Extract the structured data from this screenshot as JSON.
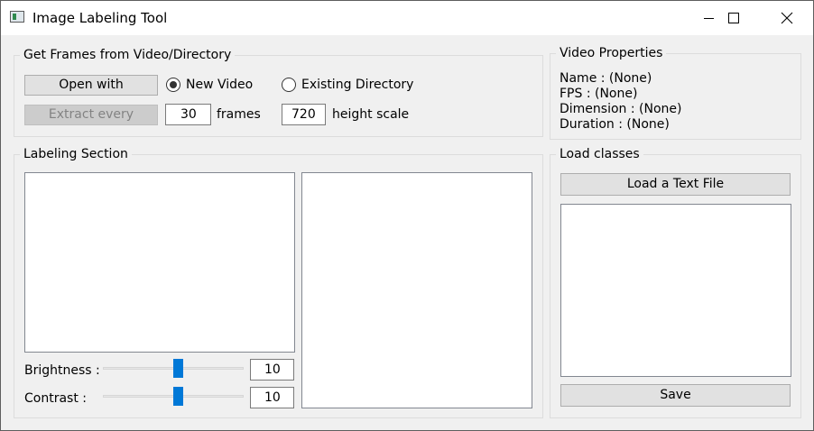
{
  "window": {
    "title": "Image Labeling Tool"
  },
  "frames_group": {
    "title": "Get Frames from Video/Directory",
    "open_with_label": "Open with",
    "new_video_label": "New Video",
    "new_video_checked": true,
    "existing_dir_label": "Existing Directory",
    "existing_dir_checked": false,
    "extract_every_label": "Extract every",
    "frames_value": "30",
    "frames_label": "frames",
    "height_value": "720",
    "height_label": "height scale"
  },
  "video_properties": {
    "title": "Video Properties",
    "name": "Name : (None)",
    "fps": "FPS : (None)",
    "dimension": "Dimension : (None)",
    "duration": "Duration : (None)"
  },
  "labeling": {
    "title": "Labeling Section",
    "brightness_label": "Brightness :",
    "brightness_value": "10",
    "brightness_level": 0.5,
    "contrast_label": "Contrast :",
    "contrast_value": "10",
    "contrast_level": 0.5
  },
  "classes": {
    "title": "Load classes",
    "load_button": "Load a Text File",
    "save_button": "Save"
  }
}
